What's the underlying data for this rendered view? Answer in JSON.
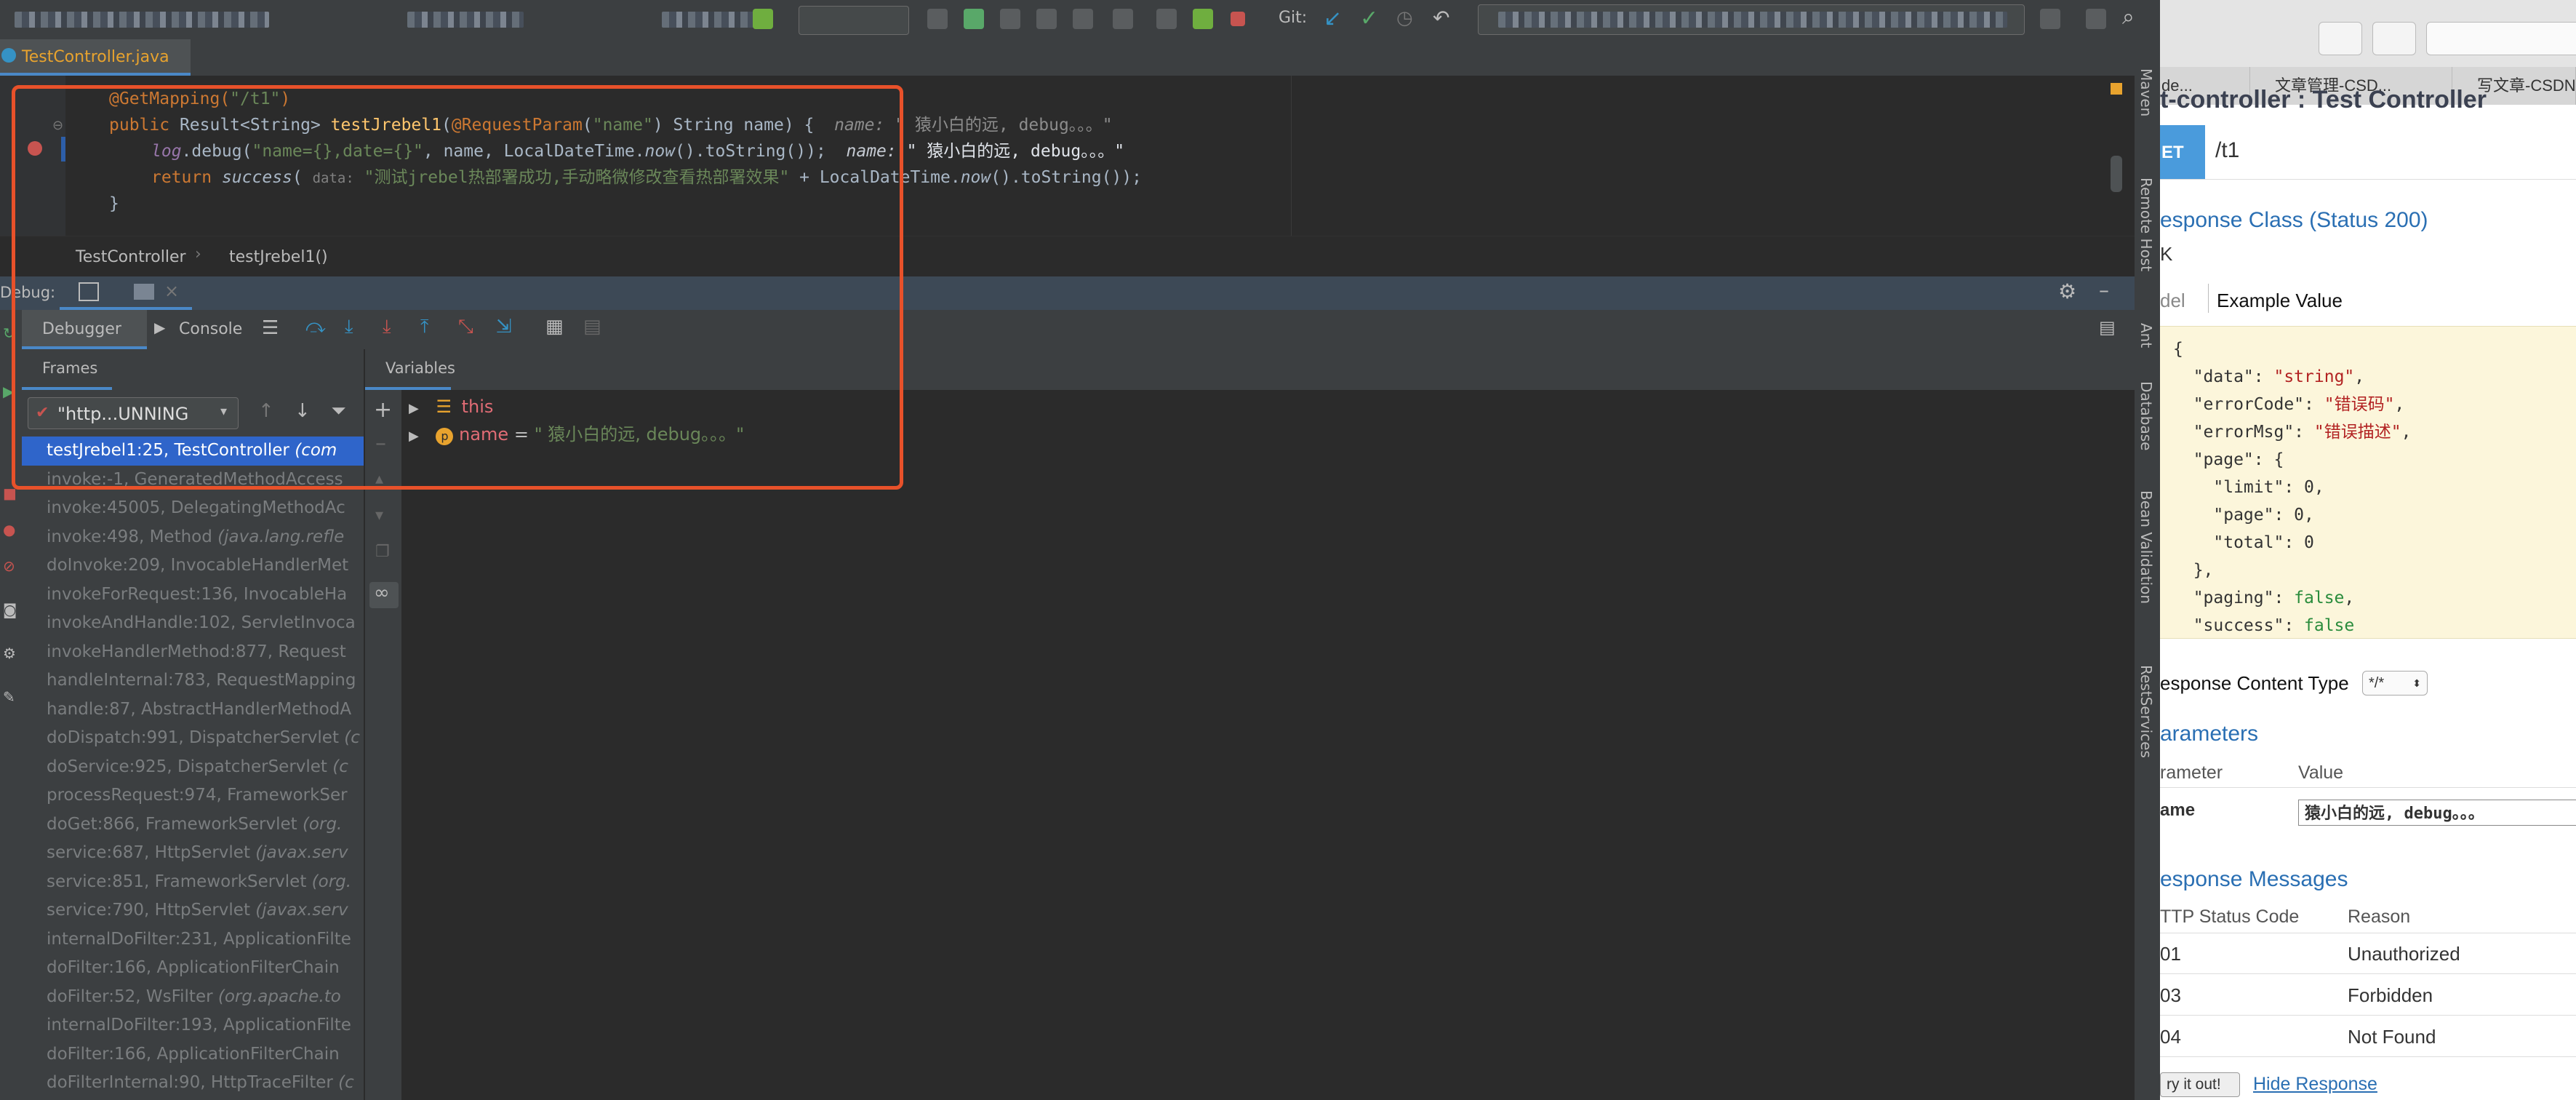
{
  "toolbar": {
    "git_label": "Git:"
  },
  "editor": {
    "tab_file": "TestController.java",
    "lines": {
      "l1_annotation": "@GetMapping(",
      "l1_string": "\"/t1\"",
      "l1_close": ")",
      "l2_public": "public",
      "l2_result": " Result<String> ",
      "l2_method": "testJrebel1",
      "l2_params_a": "(",
      "l2_reqparam": "@RequestParam",
      "l2_params_b": "(",
      "l2_name_str": "\"name\"",
      "l2_params_c": ") String name) {",
      "l2_hint_label": "name:",
      "l2_hint_value": "\" 猿小白的远, debug。。。\"",
      "l3_log": "log",
      "l3_debug": ".debug(",
      "l3_str": "\"name={},date={}\"",
      "l3_rest_a": ", name, LocalDateTime.",
      "l3_now": "now",
      "l3_rest_b": "().toString());",
      "l3_hint_label": "name:",
      "l3_hint_value": "\" 猿小白的远, debug。。。\"",
      "l4_return": "return",
      "l4_success": "success",
      "l4_paren": "(",
      "l4_hint": "data:",
      "l4_str": "\"测试jrebel热部署成功,手动略微修改查看热部署效果\"",
      "l4_rest_a": " + LocalDateTime.",
      "l4_now": "now",
      "l4_rest_b": "().toString());",
      "l5_brace": "}"
    },
    "breadcrumb": [
      "TestController",
      "testJrebel1()"
    ]
  },
  "debug": {
    "title": "Debug:",
    "tabs": [
      "Debugger",
      "Console"
    ],
    "frames_label": "Frames",
    "variables_label": "Variables",
    "thread_select": "\"http...UNNING",
    "frames": [
      {
        "method": "testJrebel1:25, TestController",
        "cls": " (com"
      },
      {
        "method": "invoke:-1, GeneratedMethodAccess",
        "cls": ""
      },
      {
        "method": "invoke:45005, DelegatingMethodAc",
        "cls": ""
      },
      {
        "method": "invoke:498, Method",
        "cls": " (java.lang.refle"
      },
      {
        "method": "doInvoke:209, InvocableHandlerMet",
        "cls": ""
      },
      {
        "method": "invokeForRequest:136, InvocableHa",
        "cls": ""
      },
      {
        "method": "invokeAndHandle:102, ServletInvoca",
        "cls": ""
      },
      {
        "method": "invokeHandlerMethod:877, Request",
        "cls": ""
      },
      {
        "method": "handleInternal:783, RequestMapping",
        "cls": ""
      },
      {
        "method": "handle:87, AbstractHandlerMethodA",
        "cls": ""
      },
      {
        "method": "doDispatch:991, DispatcherServlet",
        "cls": " (c"
      },
      {
        "method": "doService:925, DispatcherServlet",
        "cls": " (c"
      },
      {
        "method": "processRequest:974, FrameworkSer",
        "cls": ""
      },
      {
        "method": "doGet:866, FrameworkServlet",
        "cls": " (org."
      },
      {
        "method": "service:687, HttpServlet",
        "cls": " (javax.serv"
      },
      {
        "method": "service:851, FrameworkServlet",
        "cls": " (org."
      },
      {
        "method": "service:790, HttpServlet",
        "cls": " (javax.serv"
      },
      {
        "method": "internalDoFilter:231, ApplicationFilte",
        "cls": ""
      },
      {
        "method": "doFilter:166, ApplicationFilterChain",
        "cls": ""
      },
      {
        "method": "doFilter:52, WsFilter",
        "cls": " (org.apache.to"
      },
      {
        "method": "internalDoFilter:193, ApplicationFilte",
        "cls": ""
      },
      {
        "method": "doFilter:166, ApplicationFilterChain",
        "cls": ""
      },
      {
        "method": "doFilterInternal:90, HttpTraceFilter",
        "cls": " (c"
      }
    ],
    "vars": {
      "this_label": "this",
      "name_label": "name",
      "name_eq": " = ",
      "name_value": "\" 猿小白的远, debug。。。\""
    }
  },
  "side_tools": [
    "Maven",
    "Remote Host",
    "Ant",
    "Database",
    "Bean Validation",
    "RestServices"
  ],
  "browser": {
    "tabs": [
      "de...",
      "文章管理-CSD...",
      "写文章-CSDN..."
    ],
    "title_partial": "t-controller : Test Controller",
    "method": "ET",
    "path": "/t1",
    "response_class": "esponse Class (Status 200)",
    "ok_label": "K",
    "model_label": "del",
    "example_value": "Example Value",
    "json_lines": [
      {
        "k": "  \"data\": ",
        "v": "\"string\"",
        "t": "s",
        "e": ","
      },
      {
        "k": "  \"errorCode\": ",
        "v": "\"错误码\"",
        "t": "s",
        "e": ","
      },
      {
        "k": "  \"errorMsg\": ",
        "v": "\"错误描述\"",
        "t": "s",
        "e": ","
      },
      {
        "k": "  \"page\": {",
        "v": "",
        "t": "n",
        "e": ""
      },
      {
        "k": "    \"limit\": ",
        "v": "0",
        "t": "n",
        "e": ","
      },
      {
        "k": "    \"page\": ",
        "v": "0",
        "t": "n",
        "e": ","
      },
      {
        "k": "    \"total\": ",
        "v": "0",
        "t": "n",
        "e": ""
      },
      {
        "k": "  },",
        "v": "",
        "t": "n",
        "e": ""
      },
      {
        "k": "  \"paging\": ",
        "v": "false",
        "t": "b",
        "e": ","
      },
      {
        "k": "  \"success\": ",
        "v": "false",
        "t": "b",
        "e": ""
      }
    ],
    "content_type_label": "esponse Content Type",
    "content_type_value": "*/*",
    "parameters_title": "arameters",
    "param_col": "rameter",
    "value_col": "Value",
    "param_name": "ame",
    "param_value": "猿小白的远, debug。。。",
    "messages_title": "esponse Messages",
    "status_col": "TTP Status Code",
    "reason_col": "Reason",
    "messages": [
      {
        "code": "01",
        "reason": "Unauthorized"
      },
      {
        "code": "03",
        "reason": "Forbidden"
      },
      {
        "code": "04",
        "reason": "Not Found"
      }
    ],
    "try_button": "ry it out!",
    "hide_response": "Hide Response"
  }
}
